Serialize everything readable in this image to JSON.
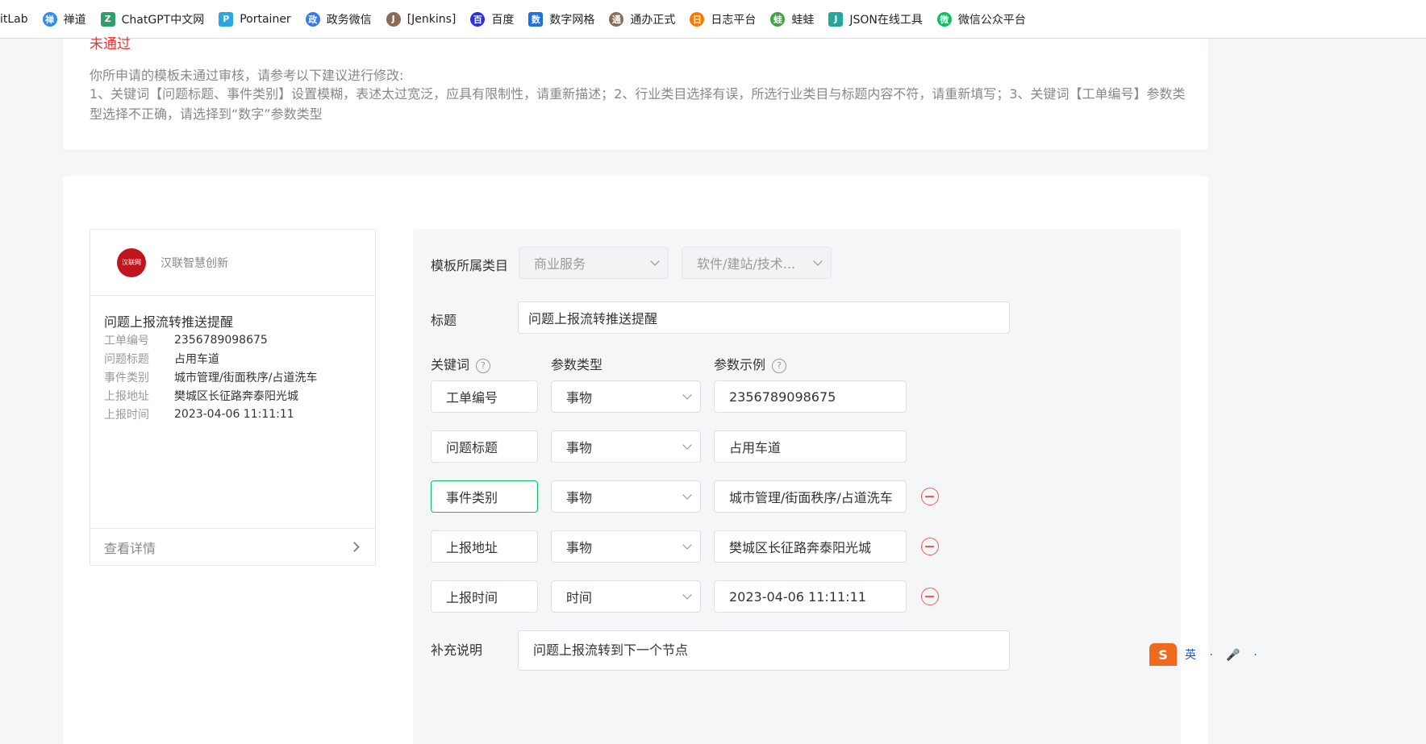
{
  "bookmarks": [
    {
      "label": "itLab",
      "icon": "gitlab-icon",
      "color": "#ffffff"
    },
    {
      "label": "禅道",
      "icon": "zentao-icon",
      "color": "#2f8cf0"
    },
    {
      "label": "ChatGPT中文网",
      "icon": "chatgpt-icon",
      "color": "#2f9e6a"
    },
    {
      "label": "Portainer",
      "icon": "portainer-icon",
      "color": "#2aa6e0"
    },
    {
      "label": "政务微信",
      "icon": "gov-wechat-icon",
      "color": "#3b7be8"
    },
    {
      "label": "[Jenkins]",
      "icon": "jenkins-icon",
      "color": "#8b6b55"
    },
    {
      "label": "百度",
      "icon": "baidu-icon",
      "color": "#2932e1"
    },
    {
      "label": "数字网格",
      "icon": "grid-icon",
      "color": "#1f6fe0"
    },
    {
      "label": "通办正式",
      "icon": "tongban-icon",
      "color": "#8b6b55"
    },
    {
      "label": "日志平台",
      "icon": "log-icon",
      "color": "#f57c00"
    },
    {
      "label": "蛙蛙",
      "icon": "frog-icon",
      "color": "#43a047"
    },
    {
      "label": "JSON在线工具",
      "icon": "json-icon",
      "color": "#26a69a"
    },
    {
      "label": "微信公众平台",
      "icon": "wechat-icon",
      "color": "#07c160"
    }
  ],
  "notice": {
    "status": "未通过",
    "intro": "你所申请的模板未通过审核，请参考以下建议进行修改:",
    "detail": "1、关键词【问题标题、事件类别】设置模糊，表述太过宽泛，应具有限制性，请重新描述；2、行业类目选择有误，所选行业类目与标题内容不符，请重新填写；3、关键词【工单编号】参数类型选择不正确，请选择到“数字”参数类型"
  },
  "preview": {
    "org_name": "汉联智慧创新",
    "logo_text": "汉联网",
    "title": "问题上报流转推送提醒",
    "rows": [
      {
        "key": "工单编号",
        "value": "2356789098675"
      },
      {
        "key": "问题标题",
        "value": "占用车道"
      },
      {
        "key": "事件类别",
        "value": "城市管理/街面秩序/占道洗车"
      },
      {
        "key": "上报地址",
        "value": "樊城区长征路奔泰阳光城"
      },
      {
        "key": "上报时间",
        "value": "2023-04-06 11:11:11"
      }
    ],
    "detail_link": "查看详情"
  },
  "form": {
    "category_label": "模板所属类目",
    "category_primary": "商业服务",
    "category_secondary": "软件/建站/技术...",
    "title_label": "标题",
    "title_value": "问题上报流转推送提醒",
    "col_keyword": "关键词",
    "col_param_type": "参数类型",
    "col_param_example": "参数示例",
    "help_glyph": "?",
    "params": [
      {
        "keyword": "工单编号",
        "type": "事物",
        "example": "2356789098675",
        "removable": false
      },
      {
        "keyword": "问题标题",
        "type": "事物",
        "example": "占用车道",
        "removable": false
      },
      {
        "keyword": "事件类别",
        "type": "事物",
        "example": "城市管理/街面秩序/占道洗车",
        "removable": true
      },
      {
        "keyword": "上报地址",
        "type": "事物",
        "example": "樊城区长征路奔泰阳光城",
        "removable": true
      },
      {
        "keyword": "上报时间",
        "type": "时间",
        "example": "2023-04-06 11:11:11",
        "removable": true
      }
    ],
    "supplement_label": "补充说明",
    "supplement_value": "问题上报流转到下一个节点"
  },
  "ime": {
    "logo": "S",
    "text": "英 · 🎤 ·"
  },
  "colors": {
    "danger": "#f25a5a",
    "accent_green": "#07c160",
    "brand_red": "#c0151f"
  }
}
